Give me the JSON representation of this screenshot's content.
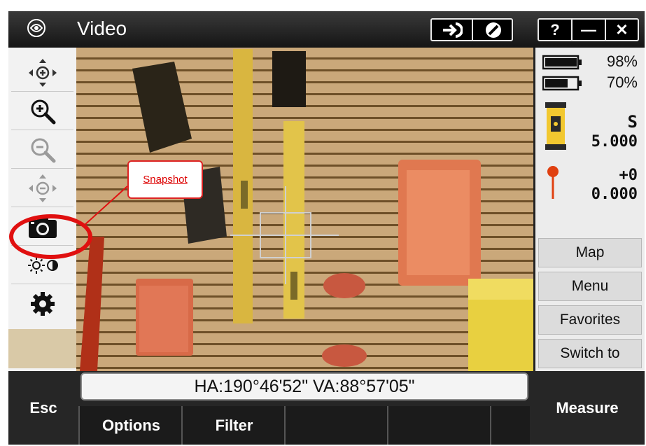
{
  "window": {
    "title": "Video"
  },
  "titlebar": {
    "buttons": [
      {
        "name": "connect-icon"
      },
      {
        "name": "no-entry-icon"
      },
      {
        "name": "help",
        "label": "?"
      },
      {
        "name": "minimize",
        "label": "—"
      },
      {
        "name": "close",
        "label": "✕"
      }
    ]
  },
  "toolbar": {
    "tools": [
      {
        "name": "pan-icon"
      },
      {
        "name": "zoom-in-icon"
      },
      {
        "name": "zoom-out-icon"
      },
      {
        "name": "zoom-extents-icon"
      },
      {
        "name": "camera-icon"
      },
      {
        "name": "brightness-contrast-icon"
      },
      {
        "name": "settings-icon"
      }
    ]
  },
  "callout": {
    "label": "Snapshot"
  },
  "status": {
    "battery1": "98%",
    "battery2": "70%",
    "instrument_mode": "S",
    "instrument_value": "5.000",
    "target_offset": "+0",
    "target_height": "0.000"
  },
  "softkeys": {
    "map": "Map",
    "menu": "Menu",
    "favorites": "Favorites",
    "switch_to": "Switch to"
  },
  "readout": {
    "angles": "HA:190°46'52\"   VA:88°57'05\""
  },
  "bottom": {
    "esc": "Esc",
    "options": "Options",
    "filter": "Filter",
    "measure": "Measure"
  },
  "colors": {
    "accent_red": "#e01010",
    "background_dark": "#232323"
  }
}
